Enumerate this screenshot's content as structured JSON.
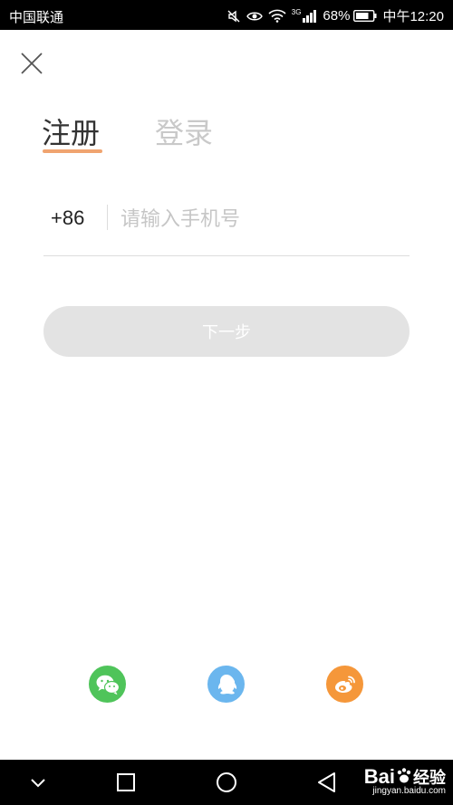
{
  "status_bar": {
    "carrier": "中国联通",
    "network": "3G",
    "battery": "68%",
    "time": "中午12:20"
  },
  "tabs": {
    "register": "注册",
    "login": "登录",
    "active": "register"
  },
  "phone": {
    "prefix": "+86",
    "placeholder": "请输入手机号",
    "value": ""
  },
  "next_button": {
    "label": "下一步"
  },
  "colors": {
    "accent": "#f0a470",
    "wechat": "#4fc45a",
    "qq": "#6bb6ee",
    "weibo": "#f5973a"
  },
  "social_icons": [
    "wechat-icon",
    "qq-icon",
    "weibo-icon"
  ],
  "watermark": {
    "brand": "Bai",
    "brand_suffix": "经验",
    "url": "jingyan.baidu.com"
  }
}
